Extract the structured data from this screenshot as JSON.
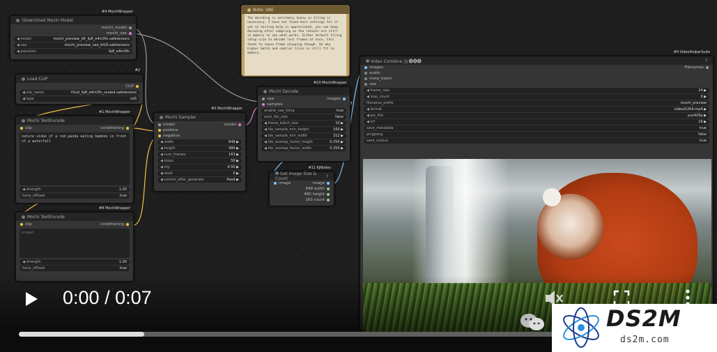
{
  "colors": {
    "accent": "#7ec8ff",
    "wire_yellow": "#f5c542",
    "wire_pink": "#e27bd4",
    "wire_gray": "#9a9a9a",
    "note_bg": "#e6dcc5"
  },
  "nodes": {
    "download": {
      "tag": "#4 MochiWrapper",
      "title": "(Down)load Mochi Model",
      "outputs": [
        "mochi_model",
        "mochi_vae"
      ],
      "widgets": [
        {
          "label": "model",
          "value": "mochi_preview_dit_fp8_e4m3fn.safetensors"
        },
        {
          "label": "vae",
          "value": "mochi_preview_vae_bf16.safetensors"
        },
        {
          "label": "precision",
          "value": "fp8_e4m3fn"
        }
      ]
    },
    "clip": {
      "tag": "#2",
      "title": "Load CLIP",
      "output": "CLIP",
      "widgets": [
        {
          "label": "clip_name",
          "value": "t5xxl_fp8_e4m3fn_scaled.safetensors"
        },
        {
          "label": "type",
          "value": "sd3"
        }
      ]
    },
    "encode_pos": {
      "tag": "#1 MochiWrapper",
      "title": "Mochi TextEncode",
      "input": "clip",
      "output": "conditioning",
      "prompt": "nature video of a red panda eating bamboo in front of a waterfall",
      "widgets": [
        {
          "label": "strength",
          "value": "1.00"
        },
        {
          "label": "force_offload",
          "value": "true"
        }
      ]
    },
    "encode_neg": {
      "tag": "#8 MochiWrapper",
      "title": "Mochi TextEncode",
      "input": "clip",
      "output": "conditioning",
      "prompt_placeholder": "prompt",
      "widgets": [
        {
          "label": "strength",
          "value": "1.00"
        },
        {
          "label": "force_offload",
          "value": "true"
        }
      ]
    },
    "sampler": {
      "tag": "#5 MochiWrapper",
      "title": "Mochi Sampler",
      "inputs": [
        "model",
        "positive",
        "negative"
      ],
      "output": "model",
      "widgets": [
        {
          "label": "width",
          "value": "848"
        },
        {
          "label": "height",
          "value": "480"
        },
        {
          "label": "num_frames",
          "value": "163"
        },
        {
          "label": "steps",
          "value": "50"
        },
        {
          "label": "cfg",
          "value": "4.50"
        },
        {
          "label": "seed",
          "value": "0"
        },
        {
          "label": "control_after_generate",
          "value": "fixed"
        }
      ]
    },
    "note": {
      "title": "Note: VAE",
      "text": "The decoding is extremely heavy so tiling is necessary, I have not found best settings for it yet so testing help is appreciated, you can keep decoding after sampling as the latents are still in memory to see what works.\n\nEither default tiling setup size to decode less frames at once, this tends to cause frame skipping though.\n\nOn any higher batch and smaller tiles is still fit in memory."
    },
    "decode": {
      "tag": "#10 MochiWrapper",
      "title": "Mochi Decode",
      "inputs": [
        "vae",
        "samples"
      ],
      "output": "images",
      "widgets": [
        {
          "label": "enable_vae_tiling",
          "value": "true"
        },
        {
          "label": "auto_tile_size",
          "value": "false"
        },
        {
          "label": "frame_batch_size",
          "value": "10"
        },
        {
          "label": "tile_sample_min_height",
          "value": "160"
        },
        {
          "label": "tile_sample_min_width",
          "value": "312"
        },
        {
          "label": "tile_overlap_factor_height",
          "value": "0.250"
        },
        {
          "label": "tile_overlap_factor_width",
          "value": "0.250"
        }
      ]
    },
    "getsize": {
      "tag": "#11 KJNodes",
      "title": "Get Image Size & Count",
      "badge": "?",
      "input": "image",
      "outputs": [
        "image",
        "848 width",
        "480 height",
        "163 count"
      ]
    },
    "combine": {
      "tag": "#9 VideoHelperSuite",
      "title": "Video Combine 🎥🅥🅗🅢",
      "inputs": [
        "images",
        "audio",
        "meta_batch",
        "vae"
      ],
      "output": "Filenames",
      "widgets": [
        {
          "label": "frame_rate",
          "value": "24"
        },
        {
          "label": "loop_count",
          "value": "0"
        },
        {
          "label": "filename_prefix",
          "value": "mochi_preview"
        },
        {
          "label": "format",
          "value": "video/h264-mp4"
        },
        {
          "label": "pix_fmt",
          "value": "yuv420p"
        },
        {
          "label": "crf",
          "value": "19"
        },
        {
          "label": "save_metadata",
          "value": "true"
        },
        {
          "label": "pingpong",
          "value": "false"
        },
        {
          "label": "save_output",
          "value": "true"
        }
      ]
    }
  },
  "player": {
    "current_time": "0:00",
    "duration": "0:07",
    "time_separator": " / ",
    "progress": 0.185
  },
  "icons": [
    "play-icon",
    "mute-icon",
    "fullscreen-icon",
    "more-icon",
    "wechat-icon"
  ],
  "watermark": {
    "main": "DS2M",
    "sub": "ds2m.com"
  }
}
